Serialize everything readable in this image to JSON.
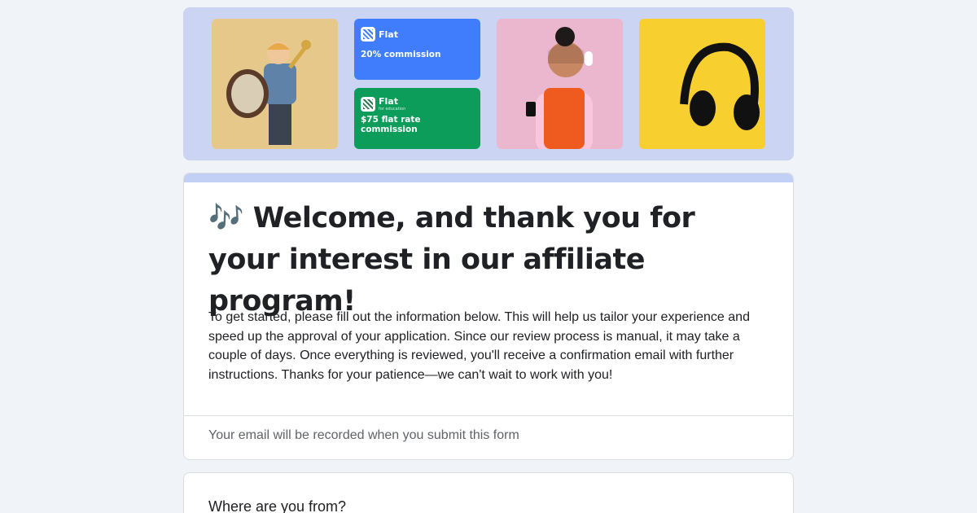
{
  "banner": {
    "cards": [
      {
        "brand": "Flat",
        "subtext": "",
        "text": "20% commission"
      },
      {
        "brand": "Flat",
        "subtext": "for education",
        "text": "$75 flat rate commission"
      }
    ]
  },
  "form": {
    "title": "🎶 Welcome, and thank you for your interest in our affiliate program!",
    "description": "To get started, please fill out the information below. This will help us tailor your experience and speed up the approval of your application. Since our review process is manual, it may take a couple of days. Once everything is reviewed, you'll receive a confirmation email with further instructions. Thanks for your patience—we can't wait to work with you!",
    "email_note": "Your email will be recorded when you submit this form"
  },
  "question": {
    "title": "Where are you from?"
  },
  "colors": {
    "background": "#f0f3f8",
    "banner": "#cbd5f3",
    "blue_card": "#3f7dfc",
    "green_card": "#0c9d5a",
    "pink_tile": "#eab7cf",
    "yellow_tile": "#f7cf2f"
  },
  "icons": [
    "drummer-photo",
    "flat-logo-icon",
    "woman-with-phone-photo",
    "headphones-photo"
  ]
}
